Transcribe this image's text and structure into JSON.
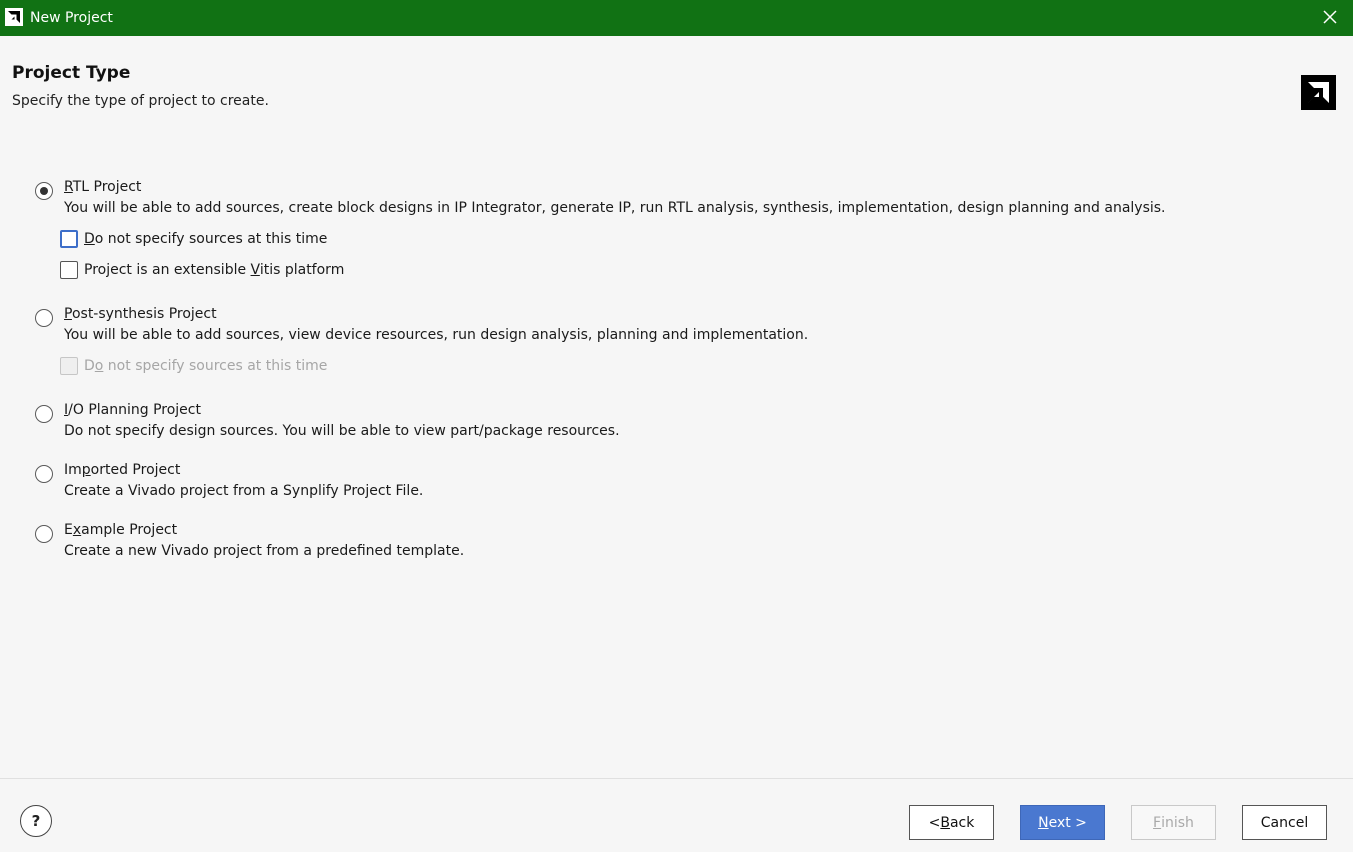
{
  "window": {
    "title": "New Project"
  },
  "header": {
    "title": "Project Type",
    "subtitle": "Specify the type of project to create."
  },
  "options": [
    {
      "title_mnemonic": "R",
      "title_rest": "TL Project",
      "description": "You will be able to add sources, create block designs in IP Integrator, generate IP, run RTL analysis, synthesis, implementation, design planning and analysis.",
      "selected": true,
      "checkboxes": [
        {
          "pre": "",
          "mn": "D",
          "post": "o not specify sources at this time",
          "checked": false,
          "enabled": true,
          "focused": true
        },
        {
          "pre": "Project is an extensible ",
          "mn": "V",
          "post": "itis platform",
          "checked": false,
          "enabled": true,
          "focused": false
        }
      ]
    },
    {
      "title_mnemonic": "P",
      "title_rest": "ost-synthesis Project",
      "description": "You will be able to add sources, view device resources, run design analysis, planning and implementation.",
      "selected": false,
      "checkboxes": [
        {
          "pre": "D",
          "mn": "o",
          "post": " not specify sources at this time",
          "checked": false,
          "enabled": false,
          "focused": false
        }
      ]
    },
    {
      "title_mnemonic": "I",
      "title_rest": "/O Planning Project",
      "description": "Do not specify design sources. You will be able to view part/package resources.",
      "selected": false
    },
    {
      "title_pre": "Im",
      "title_mnemonic": "p",
      "title_rest": "orted Project",
      "description": "Create a Vivado project from a Synplify Project File.",
      "selected": false
    },
    {
      "title_pre": "E",
      "title_mnemonic": "x",
      "title_rest": "ample Project",
      "description": "Create a new Vivado project from a predefined template.",
      "selected": false
    }
  ],
  "footer": {
    "help_label": "?",
    "back": {
      "pre": "< ",
      "mn": "B",
      "post": "ack"
    },
    "next": {
      "mn": "N",
      "post": "ext >"
    },
    "finish": {
      "mn": "F",
      "post": "inish",
      "enabled": false
    },
    "cancel": {
      "label": "Cancel"
    }
  },
  "colors": {
    "titlebar": "#117214",
    "primary_button": "#4a78d0",
    "focus": "#3d6ec9"
  },
  "icons": {
    "app": "amd-logo-icon",
    "close": "close-icon",
    "brand": "amd-logo-icon",
    "help": "help-icon"
  }
}
